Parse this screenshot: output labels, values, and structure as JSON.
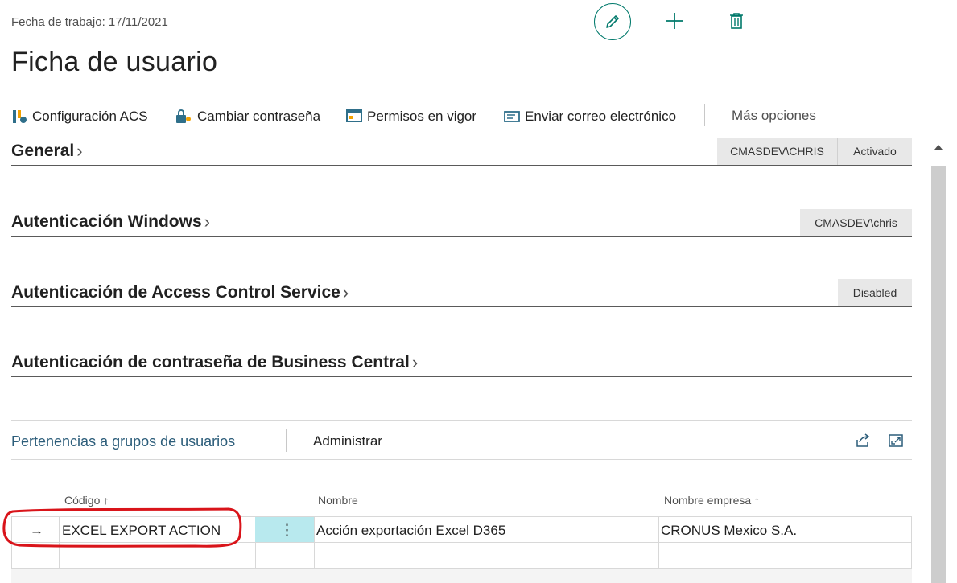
{
  "header": {
    "work_date": "Fecha de trabajo: 17/11/2021",
    "title": "Ficha de usuario"
  },
  "actions": {
    "acs_config": "Configuración ACS",
    "change_password": "Cambiar contraseña",
    "effective_permissions": "Permisos en vigor",
    "send_email": "Enviar correo electrónico",
    "more_options": "Más opciones"
  },
  "fasttabs": {
    "general": {
      "title": "General",
      "user": "CMASDEV\\CHRIS",
      "state": "Activado"
    },
    "windows_auth": {
      "title": "Autenticación Windows",
      "value": "CMASDEV\\chris"
    },
    "acs_auth": {
      "title": "Autenticación de Access Control Service",
      "value": "Disabled"
    },
    "password_auth": {
      "title": "Autenticación de contraseña de Business Central"
    }
  },
  "part": {
    "title": "Pertenencias a grupos de usuarios",
    "admin": "Administrar",
    "columns": {
      "code": "Código ↑",
      "name": "Nombre",
      "company": "Nombre empresa ↑"
    },
    "rows": [
      {
        "indicator": "→",
        "code": "EXCEL EXPORT ACTION",
        "name": "Acción exportación Excel D365",
        "company": "CRONUS Mexico S.A."
      },
      {
        "indicator": "",
        "code": "",
        "name": "",
        "company": ""
      }
    ]
  },
  "icons": {
    "edit": "pencil-icon",
    "new": "plus-icon",
    "delete": "trash-icon",
    "share": "share-icon",
    "expand": "expand-icon",
    "scroll_up": "caret-up-icon"
  },
  "colors": {
    "accent": "#00796b",
    "selected_cell": "#b8e9ee",
    "annotation": "#d9141a"
  }
}
